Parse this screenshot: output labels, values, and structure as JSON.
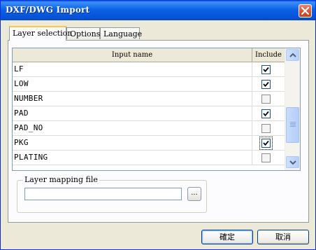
{
  "window": {
    "title": "DXF/DWG Import"
  },
  "tabs": [
    {
      "label": "Layer selection",
      "active": true
    },
    {
      "label": "Options",
      "active": false
    },
    {
      "label": "Language",
      "active": false
    }
  ],
  "grid": {
    "columns": {
      "name": "Input name",
      "include": "Include"
    },
    "rows": [
      {
        "name": "LF",
        "include": true
      },
      {
        "name": "LOW",
        "include": true
      },
      {
        "name": "NUMBER",
        "include": false
      },
      {
        "name": "PAD",
        "include": true
      },
      {
        "name": "PAD_NO",
        "include": false
      },
      {
        "name": "PKG",
        "include": true,
        "focused": true
      },
      {
        "name": "PLATING",
        "include": false
      }
    ]
  },
  "mapping": {
    "legend": "Layer mapping file",
    "value": "",
    "browse_label": "..."
  },
  "buttons": {
    "ok": "確定",
    "cancel": "取消"
  },
  "icons": {
    "close": "close-icon",
    "scroll_up": "chevron-up-icon",
    "scroll_down": "chevron-down-icon",
    "check": "checkmark-icon"
  },
  "colors": {
    "titlebar": "#0553d8",
    "close_button": "#d6512e",
    "tab_highlight": "#ffc83c",
    "dialog_bg": "#ece9d8"
  }
}
